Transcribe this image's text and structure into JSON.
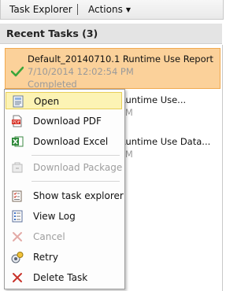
{
  "toolbar": {
    "explorer_label": "Task Explorer",
    "actions_label": "Actions"
  },
  "recent": {
    "header": "Recent Tasks (3)"
  },
  "tasks": [
    {
      "title": "Default_20140710.1 Runtime Use Report",
      "date": "7/10/2014 12:02:54 PM",
      "status": "Completed"
    },
    {
      "title": "Runtime Use...",
      "date": "PM"
    },
    {
      "title": "Runtime Use Data...",
      "date": "PM"
    }
  ],
  "menu": {
    "items": [
      {
        "label": "Open",
        "icon": "open-document-icon"
      },
      {
        "label": "Download PDF",
        "icon": "pdf-icon"
      },
      {
        "label": "Download Excel",
        "icon": "excel-icon"
      },
      {
        "label": "Download Package",
        "icon": "package-icon"
      },
      {
        "label": "Show task explorer",
        "icon": "task-explorer-icon"
      },
      {
        "label": "View Log",
        "icon": "log-icon"
      },
      {
        "label": "Cancel",
        "icon": "cancel-icon"
      },
      {
        "label": "Retry",
        "icon": "retry-icon"
      },
      {
        "label": "Delete Task",
        "icon": "delete-icon"
      }
    ]
  },
  "colors": {
    "selected_task_bg": "#fbd19a",
    "hover_item_bg": "#fcf3b4",
    "check_green": "#3aa63a"
  }
}
